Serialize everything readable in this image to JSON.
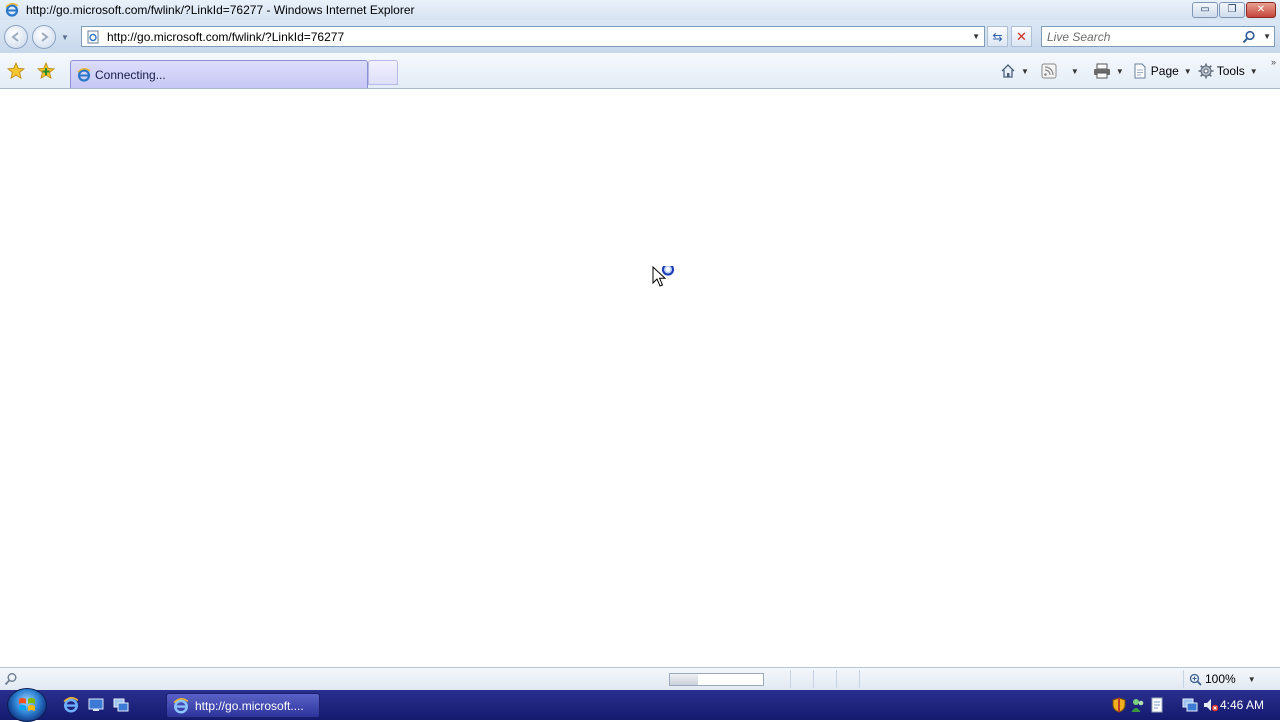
{
  "window": {
    "title": "http://go.microsoft.com/fwlink/?LinkId=76277 - Windows Internet Explorer",
    "minimize_glyph": "▭",
    "restore_glyph": "❐",
    "close_glyph": "✕"
  },
  "navbar": {
    "url": "http://go.microsoft.com/fwlink/?LinkId=76277",
    "search_placeholder": "Live Search",
    "refresh_glyph": "⇆",
    "stop_glyph": "✕"
  },
  "tabs": [
    {
      "label": "Connecting..."
    }
  ],
  "command_bar": {
    "page_label": "Page",
    "tools_label": "Tools",
    "dropdown_glyph": "▼",
    "more_glyph": "»"
  },
  "status_bar": {
    "progress": 0.3,
    "zoom_label": "100%"
  },
  "taskbar": {
    "task_label": "http://go.microsoft....",
    "clock": "4:46 AM"
  },
  "colors": {
    "tab_active": "#c7c8f5",
    "taskbar": "#1c2280",
    "stop_red": "#d12a1e"
  }
}
